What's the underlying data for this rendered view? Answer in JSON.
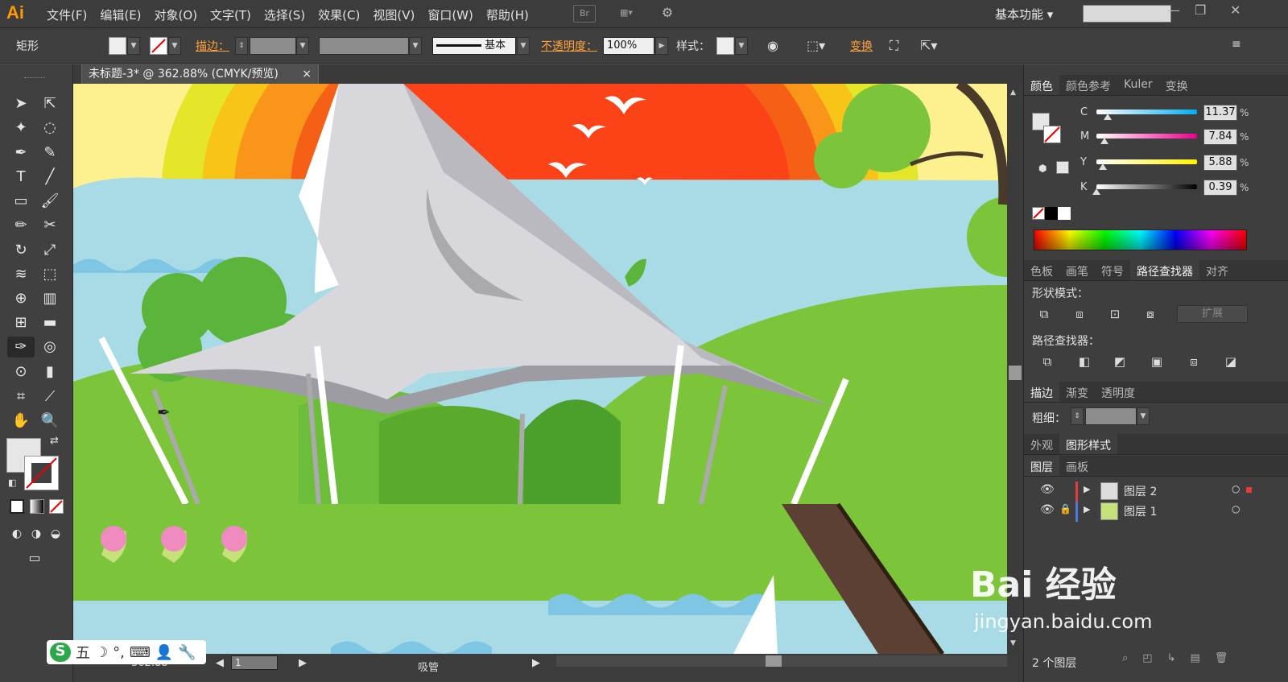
{
  "app": {
    "logo": "Ai",
    "bridge": "Br"
  },
  "menu": [
    "文件(F)",
    "编辑(E)",
    "对象(O)",
    "文字(T)",
    "选择(S)",
    "效果(C)",
    "视图(V)",
    "窗口(W)",
    "帮助(H)"
  ],
  "workspace": {
    "label": "基本功能",
    "search_placeholder": ""
  },
  "control": {
    "object_type": "矩形",
    "stroke_label": "描边：",
    "brush_label": "基本",
    "opacity_label": "不透明度：",
    "opacity_value": "100%",
    "style_label": "样式：",
    "transform_label": "变换"
  },
  "document": {
    "tab_title": "未标题-3* @ 362.88% (CMYK/预览)",
    "close": "×"
  },
  "color_panel": {
    "tabs": [
      "颜色",
      "颜色参考",
      "Kuler",
      "变换"
    ],
    "channels": [
      {
        "letter": "C",
        "value": "11.37",
        "fill": 0.11,
        "gradient": "#00aeef"
      },
      {
        "letter": "M",
        "value": "7.84",
        "fill": 0.08,
        "gradient": "#ec008c"
      },
      {
        "letter": "Y",
        "value": "5.88",
        "fill": 0.06,
        "gradient": "#fff200"
      },
      {
        "letter": "K",
        "value": "0.39",
        "fill": 0.0,
        "gradient": "#000000"
      }
    ],
    "percent": "%"
  },
  "pathfinder_panel": {
    "tabs": [
      "色板",
      "画笔",
      "符号",
      "路径查找器",
      "对齐"
    ],
    "shape_modes": "形状模式：",
    "expand": "扩展",
    "pathfinders": "路径查找器："
  },
  "stroke_panel": {
    "tabs": [
      "描边",
      "渐变",
      "透明度"
    ],
    "weight_label": "粗细："
  },
  "appearance_panel": {
    "tabs": [
      "外观",
      "图形样式"
    ]
  },
  "layers_panel": {
    "tabs": [
      "图层",
      "画板"
    ],
    "layers": [
      {
        "name": "图层 2",
        "color": "#e83a3a",
        "locked": false
      },
      {
        "name": "图层 1",
        "color": "#4a78e0",
        "locked": true
      }
    ],
    "count": "2 个图层"
  },
  "status": {
    "zoom": "362.88",
    "artboard": "1",
    "tool": "吸管"
  },
  "ime": {
    "mode": "五"
  },
  "watermark": {
    "brand": "Bai 经验",
    "url": "jingyan.baidu.com"
  }
}
